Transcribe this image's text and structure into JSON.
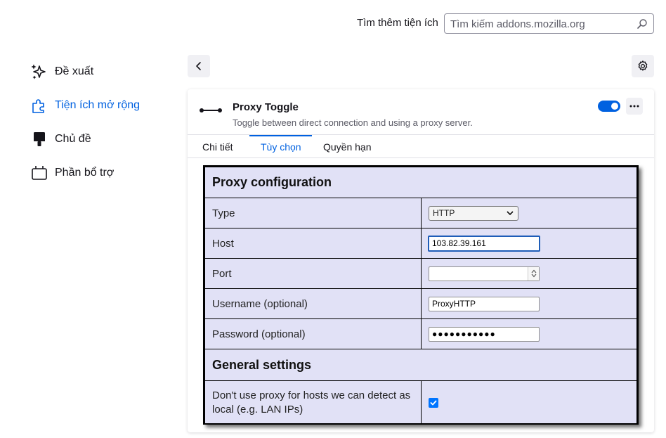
{
  "header": {
    "find_label": "Tìm thêm tiện ích",
    "search_placeholder": "Tìm kiếm addons.mozilla.org"
  },
  "sidebar": {
    "items": [
      {
        "label": "Đề xuất",
        "icon": "sparkle-icon",
        "active": false
      },
      {
        "label": "Tiện ích mở rộng",
        "icon": "puzzle-icon",
        "active": true
      },
      {
        "label": "Chủ đề",
        "icon": "paintbrush-icon",
        "active": false
      },
      {
        "label": "Phần bổ trợ",
        "icon": "plugin-icon",
        "active": false
      }
    ]
  },
  "addon": {
    "name": "Proxy Toggle",
    "description": "Toggle between direct connection and using a proxy server.",
    "enabled": true,
    "tabs": [
      {
        "label": "Chi tiết",
        "active": false
      },
      {
        "label": "Tùy chọn",
        "active": true
      },
      {
        "label": "Quyền hạn",
        "active": false
      }
    ]
  },
  "options": {
    "proxy_heading": "Proxy configuration",
    "type_label": "Type",
    "type_value": "HTTP",
    "host_label": "Host",
    "host_value": "103.82.39.161",
    "port_label": "Port",
    "username_label": "Username (optional)",
    "username_value": "ProxyHTTP",
    "password_label": "Password (optional)",
    "password_value": "●●●●●●●●●●●",
    "general_heading": "General settings",
    "local_label": "Don't use proxy for hosts we can detect as local (e.g. LAN IPs)",
    "local_checked": true
  },
  "colors": {
    "accent": "#0061e0",
    "options_bg": "#e1e1f6",
    "checkbox": "#0075ff"
  }
}
